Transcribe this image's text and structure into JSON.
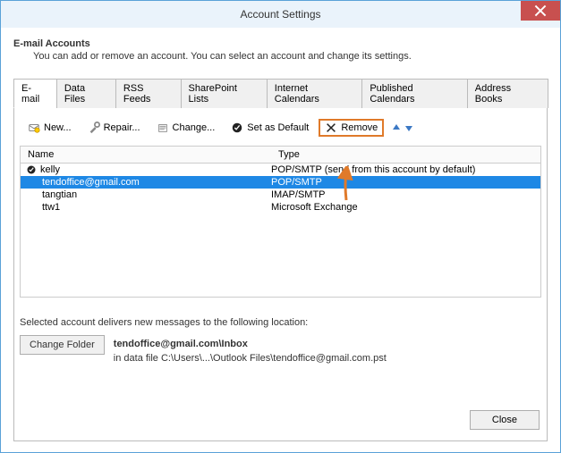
{
  "window": {
    "title": "Account Settings"
  },
  "header": {
    "title": "E-mail Accounts",
    "desc": "You can add or remove an account. You can select an account and change its settings."
  },
  "tabs": [
    {
      "label": "E-mail",
      "active": true
    },
    {
      "label": "Data Files"
    },
    {
      "label": "RSS Feeds"
    },
    {
      "label": "SharePoint Lists"
    },
    {
      "label": "Internet Calendars"
    },
    {
      "label": "Published Calendars"
    },
    {
      "label": "Address Books"
    }
  ],
  "toolbar": {
    "new": "New...",
    "repair": "Repair...",
    "change": "Change...",
    "set_default": "Set as Default",
    "remove": "Remove"
  },
  "columns": {
    "name": "Name",
    "type": "Type"
  },
  "accounts": [
    {
      "name": "kelly",
      "type": "POP/SMTP (send from this account by default)",
      "default": true
    },
    {
      "name": "tendoffice@gmail.com",
      "type": "POP/SMTP",
      "selected": true
    },
    {
      "name": "tangtian",
      "type": "IMAP/SMTP"
    },
    {
      "name": "ttw1",
      "type": "Microsoft Exchange"
    }
  ],
  "delivery": {
    "line": "Selected account delivers new messages to the following location:",
    "change_folder": "Change Folder",
    "location": "tendoffice@gmail.com\\Inbox",
    "datafile": "in data file C:\\Users\\...\\Outlook Files\\tendoffice@gmail.com.pst"
  },
  "footer": {
    "close": "Close"
  }
}
